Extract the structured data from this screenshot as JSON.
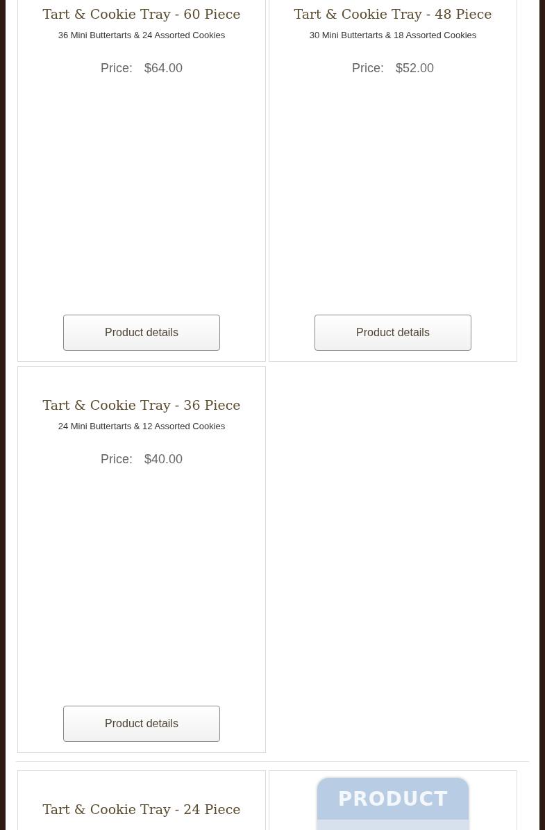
{
  "sections": [
    {
      "products": [
        {
          "kind": "product",
          "title": "Tart & Cookie Tray - 60 Piece",
          "description": "36 Mini Buttertarts & 24 Assorted Cookies",
          "price_label": "Price:",
          "price": "$64.00",
          "button": "Product details"
        },
        {
          "kind": "product",
          "title": "Tart & Cookie Tray - 48 Piece",
          "description": "30 Mini Buttertarts & 18 Assorted Cookies",
          "price_label": "Price:",
          "price": "$52.00",
          "button": "Product details"
        },
        {
          "kind": "product",
          "title": "Tart & Cookie Tray - 36 Piece",
          "description": "24 Mini Buttertarts & 12 Assorted Cookies",
          "price_label": "Price:",
          "price": "$40.00",
          "button": "Product details"
        }
      ]
    },
    {
      "products": [
        {
          "kind": "product",
          "title": "Tart & Cookie Tray - 24 Piece"
        },
        {
          "kind": "image",
          "placeholder_label": "PRODUCT"
        }
      ]
    }
  ]
}
